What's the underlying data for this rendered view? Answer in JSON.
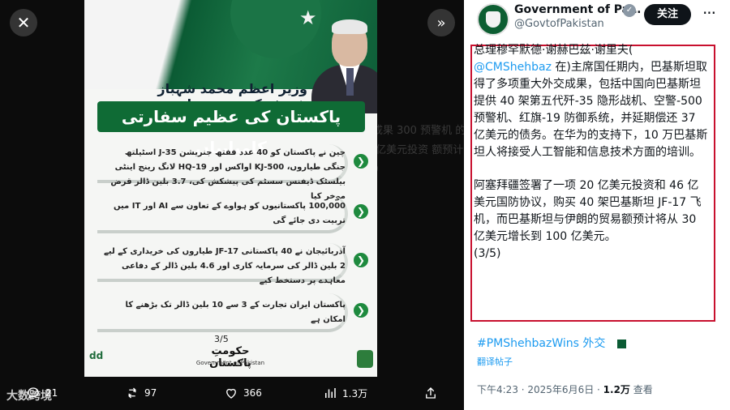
{
  "viewer": {
    "poster": {
      "urdu_subtitle": "وزیر اعظم محمد شہباز شریف کی زیر صدارت",
      "title": "پاکستان کی عظیم سفارتی کامیابیاں",
      "points": [
        {
          "text": "چین نے پاکستان کو 40 عدد ففتھ جنریشن J-35 اسٹیلتھ جنگی طیاروں، KJ-500 اواکس اور HQ-19 لانگ رینج اینٹی بیلسٹک ڈیفنس سسٹم کی پیشکش کی، 3.7 بلین ڈالر قرض موخر کیا"
        },
        {
          "text": "100,000 پاکستانیوں کو ہواوے کے تعاون سے AI اور IT میں تربیت دی جائے گی"
        },
        {
          "text": "آذربائیجان نے 40 پاکستانی JF-17 طیاروں کی خریداری کے لیے 2 بلین ڈالر کی سرمایہ کاری اور 4.6 بلین ڈالر کے دفاعی معاہدے پر دستخط کیے"
        },
        {
          "text": "پاکستان ایران تجارت کے 3 سے 10 بلین ڈالر تک بڑھنے کا امکان ہے"
        }
      ],
      "page": "3/5",
      "logo_left": "dd",
      "gov_urdu": "حکومتِ پاکستان",
      "gov_en": "Government of Pakistan"
    },
    "actions": {
      "replies": "21",
      "reposts": "97",
      "likes": "366",
      "views": "1.3万"
    },
    "ghost_text": "大外交成果 300 预警机 的支持下 亿美元投资 额预计将从 30"
  },
  "panel": {
    "author_name": "Government of Pa…",
    "handle": "@GovtofPakistan",
    "follow_label": "关注",
    "more_label": "···",
    "tweet_line1": "总理穆罕默德·谢赫巴兹·谢里夫(",
    "tweet_mention": "@CMShehbaz",
    "tweet_rest": "在)主席国任期内，巴基斯坦取得了多项重大外交成果，包括中国向巴基斯坦提供 40 架第五代歼-35 隐形战机、空警-500 预警机、红旗-19 防御系统，并延期偿还 37 亿美元的债务。在华为的支持下，10 万巴基斯坦人将接受人工智能和信息技术方面的培训。",
    "tweet_para2": "阿塞拜疆签署了一项 20 亿美元投资和 46 亿美元国防协议，购买 40 架巴基斯坦 JF-17 飞机，而巴基斯坦与伊朗的贸易额预计将从 30 亿美元增长到 100 亿美元。",
    "tweet_page": "(3/5)",
    "hashtag": "#PMShehbazWins 外交",
    "translate_label": "翻译帖子",
    "time": "下午4:23 · 2025年6月6日 · ",
    "views_count": "1.2万",
    "views_label": " 查看"
  },
  "watermark": "大数跨境",
  "colors": {
    "accent": "#1d9bf0",
    "highlight_border": "#c8102e",
    "pakistan_green": "#0f6b35"
  }
}
